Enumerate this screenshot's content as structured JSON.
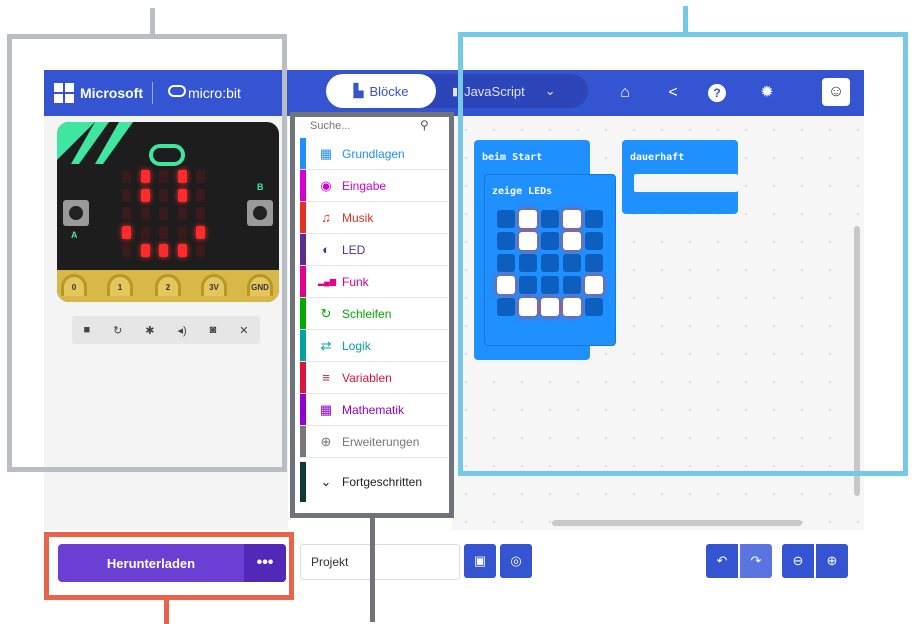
{
  "header": {
    "brand": "Microsoft",
    "product": "micro:bit",
    "tabs": [
      {
        "label": "Blöcke",
        "active": true
      },
      {
        "label": "JavaScript",
        "active": false
      }
    ],
    "icons": [
      "home-icon",
      "share-icon",
      "help-icon",
      "settings-icon",
      "account-icon"
    ],
    "color": "#3454d1"
  },
  "simulator": {
    "pins": [
      "0",
      "1",
      "2",
      "3V",
      "GND"
    ],
    "buttons": [
      "A",
      "B"
    ],
    "controls": [
      "stop-icon",
      "restart-icon",
      "debug-icon",
      "mute-icon",
      "screenshot-icon",
      "fullscreen-icon"
    ]
  },
  "toolbox": {
    "search_placeholder": "Suche...",
    "categories": [
      {
        "label": "Grundlagen",
        "color": "#1e90ff"
      },
      {
        "label": "Eingabe",
        "color": "#d400d4"
      },
      {
        "label": "Musik",
        "color": "#e63022"
      },
      {
        "label": "LED",
        "color": "#5c2d91"
      },
      {
        "label": "Funk",
        "color": "#e3008c"
      },
      {
        "label": "Schleifen",
        "color": "#00aa00"
      },
      {
        "label": "Logik",
        "color": "#00a4a6"
      },
      {
        "label": "Variablen",
        "color": "#dc143c"
      },
      {
        "label": "Mathematik",
        "color": "#9400d3"
      },
      {
        "label": "Erweiterungen",
        "color": "#777777"
      },
      {
        "label": "Fortgeschritten",
        "color": "#0e3b34"
      }
    ]
  },
  "workspace": {
    "on_start": "beim Start",
    "show_leds": "zeige LEDs",
    "forever": "dauerhaft",
    "led_grid": [
      [
        0,
        1,
        0,
        1,
        0
      ],
      [
        0,
        1,
        0,
        1,
        0
      ],
      [
        0,
        0,
        0,
        0,
        0
      ],
      [
        1,
        0,
        0,
        0,
        1
      ],
      [
        0,
        1,
        1,
        1,
        0
      ]
    ]
  },
  "bottom": {
    "download_label": "Herunterladen",
    "more_label": "•••",
    "project_name": "Projekt"
  },
  "annotations": {
    "simulator_color": "#b8bec4",
    "workspace_color": "#74c8e8",
    "toolbox_color": "#6e747a",
    "download_color": "#e8654c"
  }
}
